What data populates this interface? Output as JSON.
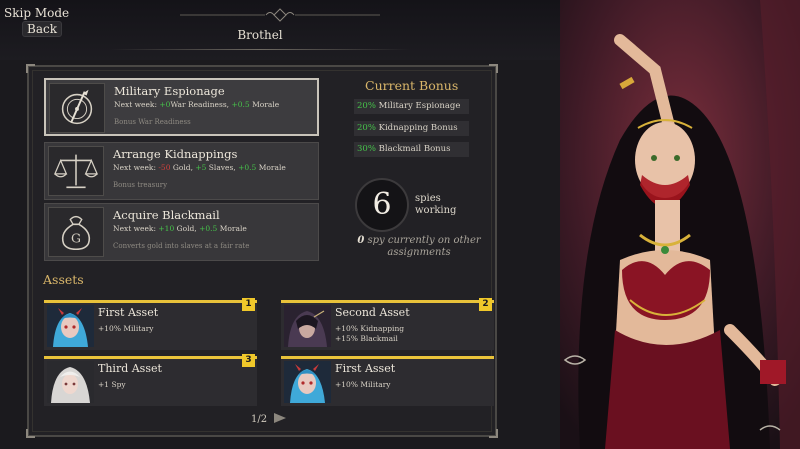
{
  "topbar": {
    "skip_mode": "Skip Mode",
    "back": "Back",
    "title": "Brothel"
  },
  "missions": [
    {
      "title": "Military Espionage",
      "next_week": "Next week:",
      "effects": [
        {
          "value": "+0",
          "label": "War Readiness,",
          "tone": "good"
        },
        {
          "value": "+0.5",
          "label": "Morale",
          "tone": "good"
        }
      ],
      "desc": "Bonus War Readiness",
      "icon": "compass-icon",
      "selected": true
    },
    {
      "title": "Arrange Kidnappings",
      "next_week": "Next week:",
      "effects": [
        {
          "value": "-50",
          "label": "Gold,",
          "tone": "bad"
        },
        {
          "value": "+5",
          "label": "Slaves,",
          "tone": "good"
        },
        {
          "value": "+0.5",
          "label": "Morale",
          "tone": "good"
        }
      ],
      "desc": "Bonus treasury",
      "icon": "scales-icon",
      "selected": false
    },
    {
      "title": "Acquire Blackmail",
      "next_week": "Next week:",
      "effects": [
        {
          "value": "+10",
          "label": "Gold,",
          "tone": "good"
        },
        {
          "value": "+0.5",
          "label": "Morale",
          "tone": "good"
        }
      ],
      "desc": "Converts gold into slaves at a fair rate",
      "icon": "money-bag-icon",
      "selected": false
    }
  ],
  "current_bonus": {
    "title": "Current Bonus",
    "items": [
      {
        "pct": "20%",
        "label": "Military Espionage"
      },
      {
        "pct": "20%",
        "label": "Kidnapping Bonus"
      },
      {
        "pct": "30%",
        "label": "Blackmail Bonus"
      }
    ]
  },
  "spies": {
    "count": "6",
    "label_line1": "spies",
    "label_line2": "working",
    "other_count": "0",
    "other_text": "spy currently on other assignments"
  },
  "assets": {
    "title": "Assets",
    "items": [
      {
        "name": "First Asset",
        "number": "1",
        "effects": [
          "+10% Military"
        ],
        "portrait": "blue-hair-demon"
      },
      {
        "name": "Second Asset",
        "number": "2",
        "effects": [
          "+10% Kidnapping",
          "+15% Blackmail"
        ],
        "portrait": "dark-hooded"
      },
      {
        "name": "Third Asset",
        "number": "3",
        "effects": [
          "+1 Spy"
        ],
        "portrait": "white-hair"
      },
      {
        "name": "First Asset",
        "number": "",
        "effects": [
          "+10% Military"
        ],
        "portrait": "blue-hair-demon"
      }
    ]
  },
  "pager": {
    "label": "1/2"
  },
  "colors": {
    "accent_gold": "#e8c23a",
    "bonus_green": "#46c24a",
    "negative_red": "#d2403c",
    "heading_gold": "#d9b66a"
  }
}
